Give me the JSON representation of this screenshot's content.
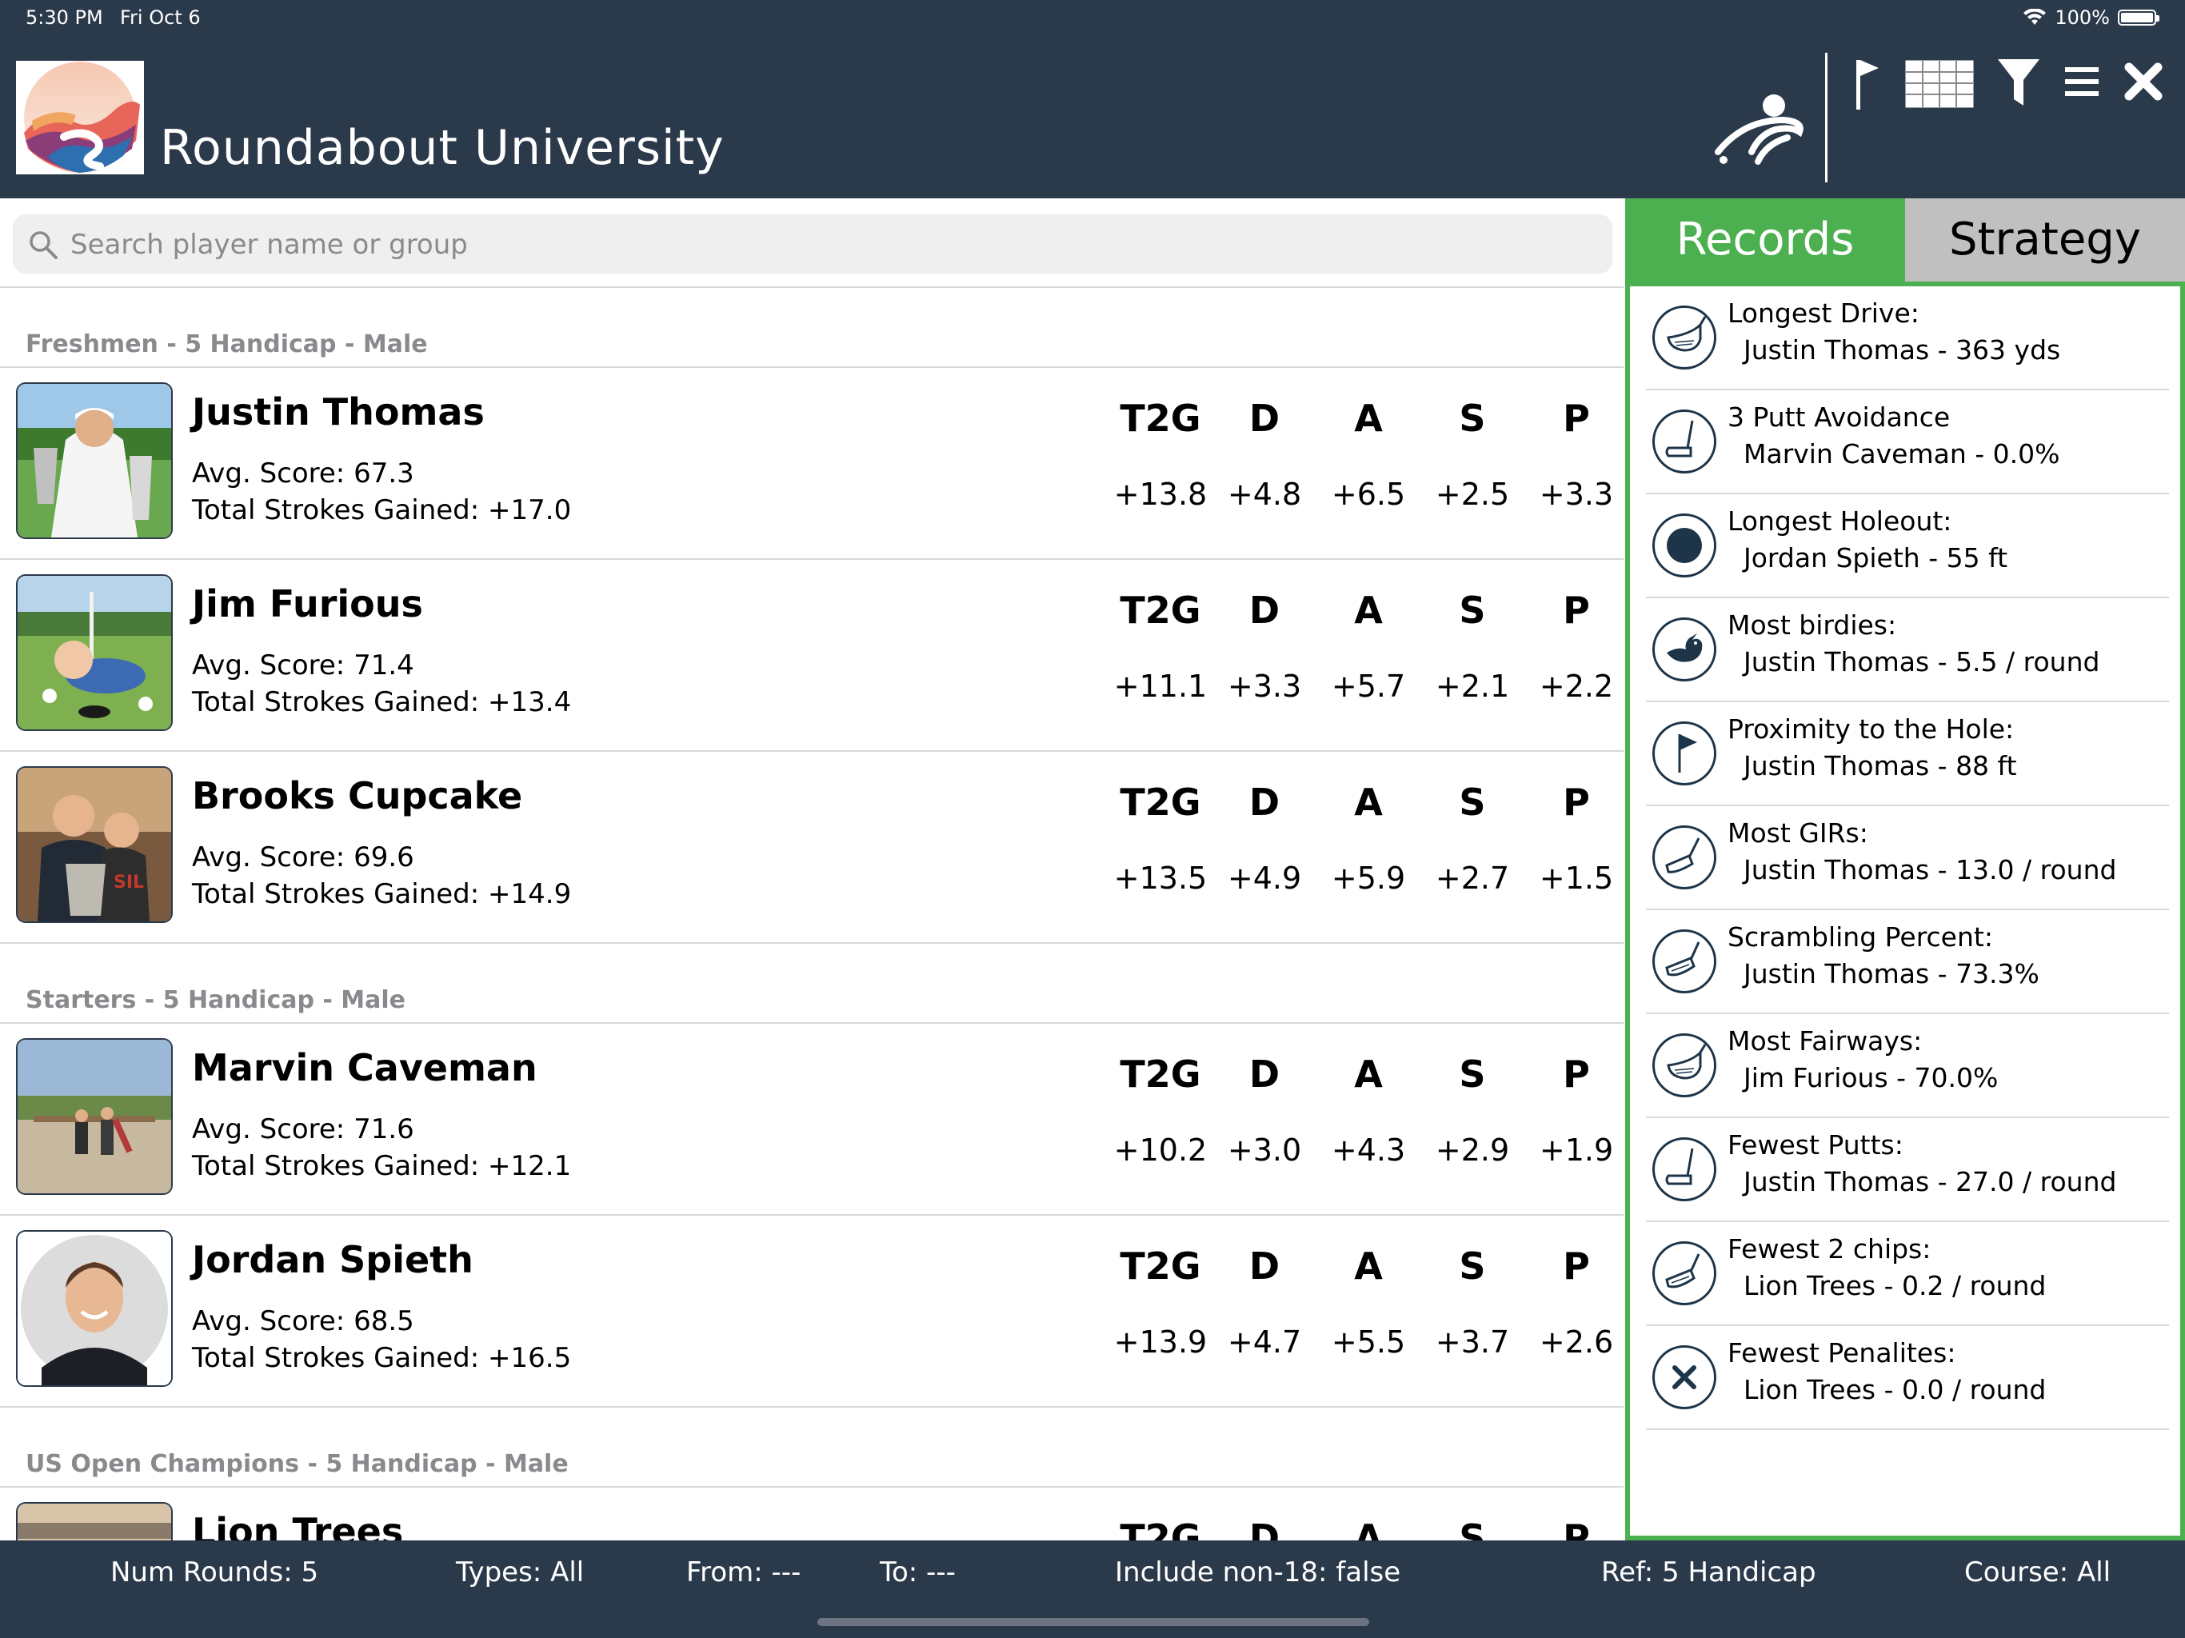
{
  "status_bar": {
    "time": "5:30 PM",
    "date": "Fri Oct 6",
    "battery": "100%"
  },
  "header": {
    "title": "Roundabout University"
  },
  "search": {
    "placeholder": "Search player name or group"
  },
  "stat_headers": [
    "T2G",
    "D",
    "A",
    "S",
    "P"
  ],
  "groups": [
    {
      "label": "Freshmen - 5 Handicap - Male",
      "players": [
        {
          "name": "Justin Thomas",
          "avg": "Avg. Score: 67.3",
          "total": "Total Strokes Gained: +17.0",
          "stats": [
            "+13.8",
            "+4.8",
            "+6.5",
            "+2.5",
            "+3.3"
          ]
        },
        {
          "name": "Jim Furious",
          "avg": "Avg. Score: 71.4",
          "total": "Total Strokes Gained: +13.4",
          "stats": [
            "+11.1",
            "+3.3",
            "+5.7",
            "+2.1",
            "+2.2"
          ]
        },
        {
          "name": "Brooks Cupcake",
          "avg": "Avg. Score: 69.6",
          "total": "Total Strokes Gained: +14.9",
          "stats": [
            "+13.5",
            "+4.9",
            "+5.9",
            "+2.7",
            "+1.5"
          ]
        }
      ]
    },
    {
      "label": "Starters - 5 Handicap - Male",
      "players": [
        {
          "name": "Marvin Caveman",
          "avg": "Avg. Score: 71.6",
          "total": "Total Strokes Gained: +12.1",
          "stats": [
            "+10.2",
            "+3.0",
            "+4.3",
            "+2.9",
            "+1.9"
          ]
        },
        {
          "name": "Jordan Spieth",
          "avg": "Avg. Score: 68.5",
          "total": "Total Strokes Gained: +16.5",
          "stats": [
            "+13.9",
            "+4.7",
            "+5.5",
            "+3.7",
            "+2.6"
          ]
        }
      ]
    },
    {
      "label": "US Open Champions - 5 Handicap - Male",
      "players": [
        {
          "name": "Lion Trees"
        }
      ]
    }
  ],
  "tabs": {
    "records": "Records",
    "strategy": "Strategy"
  },
  "records": [
    {
      "title": "Longest Drive:",
      "value": "Justin Thomas - 363 yds",
      "icon": "driver-icon"
    },
    {
      "title": "3 Putt Avoidance",
      "value": "Marvin Caveman - 0.0%",
      "icon": "putter-icon"
    },
    {
      "title": "Longest Holeout:",
      "value": "Jordan Spieth - 55 ft",
      "icon": "hole-icon"
    },
    {
      "title": "Most birdies:",
      "value": "Justin Thomas - 5.5 / round",
      "icon": "bird-icon"
    },
    {
      "title": "Proximity to the Hole:",
      "value": "Justin Thomas - 88 ft",
      "icon": "flag-icon"
    },
    {
      "title": "Most GIRs:",
      "value": "Justin Thomas - 13.0 / round",
      "icon": "iron-icon"
    },
    {
      "title": "Scrambling Percent:",
      "value": "Justin Thomas - 73.3%",
      "icon": "wedge-icon"
    },
    {
      "title": "Most Fairways:",
      "value": "Jim Furious - 70.0%",
      "icon": "driver-icon"
    },
    {
      "title": "Fewest Putts:",
      "value": "Justin Thomas - 27.0 / round",
      "icon": "putter-icon"
    },
    {
      "title": "Fewest 2 chips:",
      "value": "Lion Trees - 0.2 / round",
      "icon": "wedge-icon"
    },
    {
      "title": "Fewest Penalites:",
      "value": "Lion Trees - 0.0 / round",
      "icon": "x-icon"
    }
  ],
  "footer": {
    "num_rounds": "Num Rounds: 5",
    "types": "Types: All",
    "from": "From: ---",
    "to": "To: ---",
    "include": "Include non-18: false",
    "ref": "Ref: 5 Handicap",
    "course": "Course: All"
  },
  "colors": {
    "header_bg": "#2b3a4b",
    "accent_green": "#4cb050",
    "tab_inactive": "#c0c0c0",
    "icon_navy": "#1e3448"
  }
}
